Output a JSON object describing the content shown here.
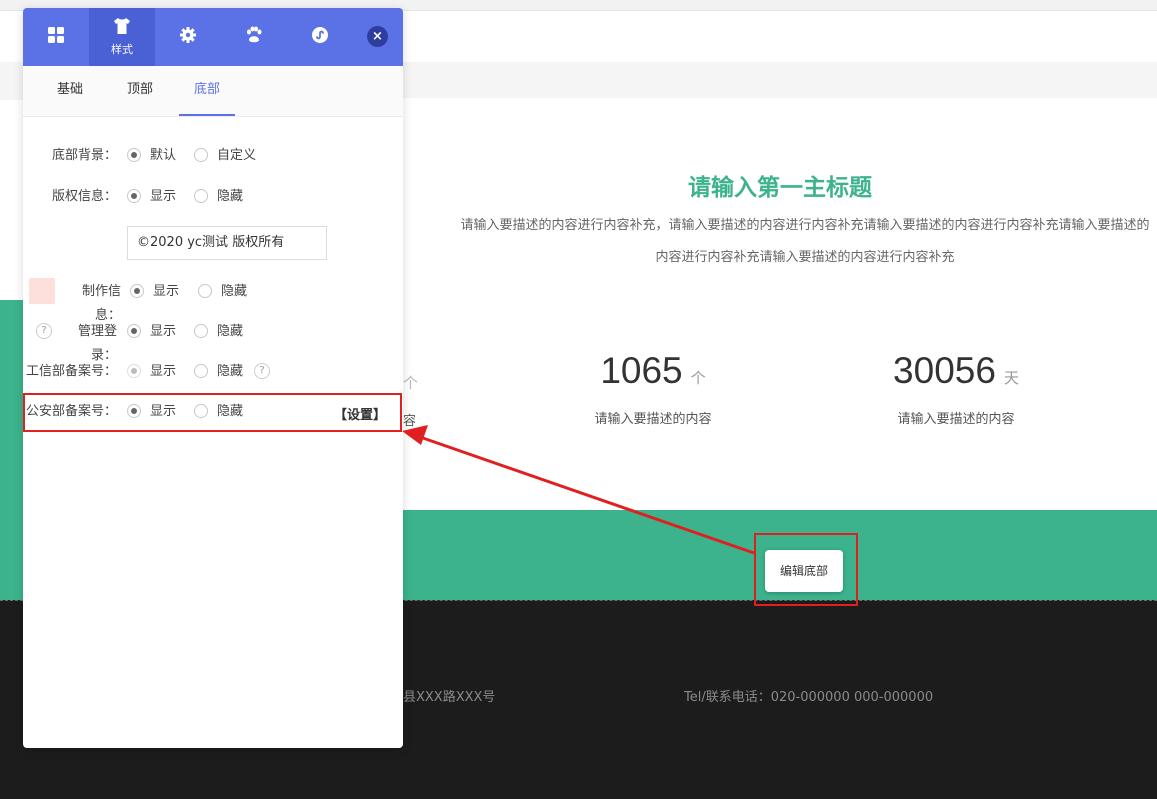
{
  "page": {
    "main_title": "请输入第一主标题",
    "main_desc": "请输入要描述的内容进行内容补充，请输入要描述的内容进行内容补充请输入要描述的内容进行内容补充请输入要描述的内容进行内容补充请输入要描述的内容进行内容补充",
    "stats": [
      {
        "value": "1065",
        "unit": "个",
        "label": "请输入要描述的内容"
      },
      {
        "value": "30056",
        "unit": "天",
        "label": "请输入要描述的内容"
      }
    ],
    "partial_unit": "个",
    "partial_label": "容",
    "edit_footer_label": "编辑底部",
    "footer_address": "县XXX路XXX号",
    "footer_tel": "Tel/联系电话：020-000000 000-000000"
  },
  "panel": {
    "header_tabs": [
      {
        "icon": "grid-icon",
        "label": ""
      },
      {
        "icon": "tshirt-icon",
        "label": "样式",
        "active": true
      },
      {
        "icon": "gear-icon",
        "label": ""
      },
      {
        "icon": "paw-icon",
        "label": ""
      },
      {
        "icon": "link-icon",
        "label": ""
      }
    ],
    "close_symbol": "×",
    "subtabs": [
      "基础",
      "顶部",
      "底部"
    ],
    "active_subtab": "底部",
    "rows": {
      "footer_bg": {
        "label": "底部背景：",
        "opt1": "默认",
        "opt2": "自定义",
        "selected": "默认"
      },
      "copyright": {
        "label": "版权信息：",
        "opt1": "显示",
        "opt2": "隐藏",
        "selected": "显示",
        "value": "©2020 yc测试 版权所有"
      },
      "maker": {
        "label": "制作信息：",
        "opt1": "显示",
        "opt2": "隐藏",
        "selected": "显示"
      },
      "admin_login": {
        "label": "管理登录：",
        "opt1": "显示",
        "opt2": "隐藏",
        "selected": "显示",
        "help": "?"
      },
      "icp": {
        "label": "工信部备案号：",
        "opt1": "显示",
        "opt2": "隐藏",
        "selected": "显示",
        "help": "?"
      },
      "police": {
        "label": "公安部备案号：",
        "opt1": "显示",
        "opt2": "隐藏",
        "selected": "显示",
        "link": "【设置】"
      }
    }
  },
  "colors": {
    "accent": "#5b72e6",
    "brand_green": "#3cb38d",
    "highlight_red": "#e02020",
    "footer_dark": "#1c1c1c"
  }
}
